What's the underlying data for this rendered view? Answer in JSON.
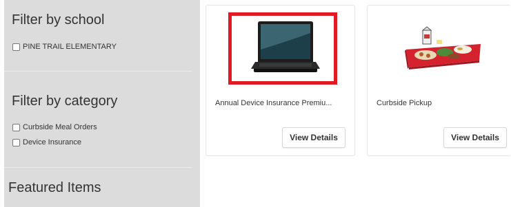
{
  "sidebar": {
    "school_filter": {
      "title": "Filter by school",
      "options": [
        "PINE TRAIL ELEMENTARY"
      ]
    },
    "category_filter": {
      "title": "Filter by category",
      "options": [
        "Curbside Meal Orders",
        "Device Insurance"
      ]
    },
    "featured_title": "Featured Items"
  },
  "products": [
    {
      "title": "Annual Device Insurance Premiu...",
      "button": "View Details",
      "image": "laptop-image",
      "highlighted": true,
      "highlight_color": "#e01b24"
    },
    {
      "title": "Curbside Pickup",
      "button": "View Details",
      "image": "lunch-tray-image",
      "highlighted": false
    }
  ]
}
